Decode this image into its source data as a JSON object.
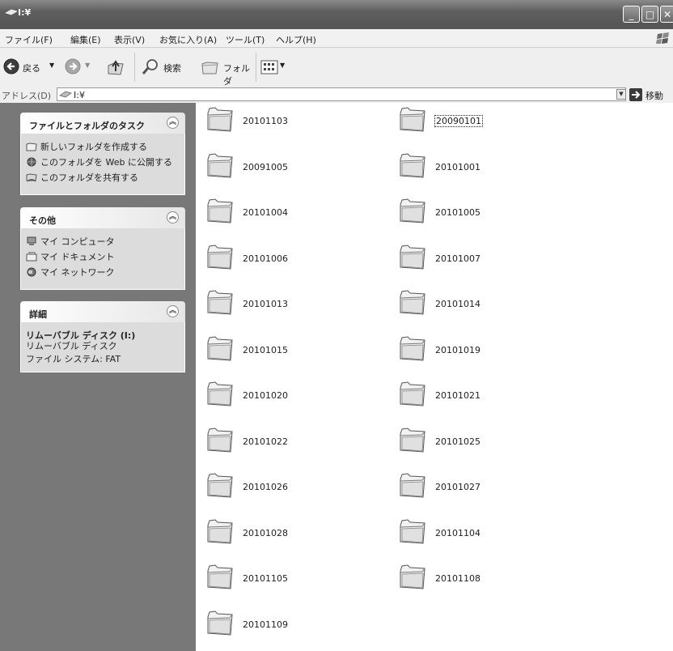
{
  "window": {
    "title": "I:¥"
  },
  "menubar": {
    "items": [
      "ファイル(F)",
      "編集(E)",
      "表示(V)",
      "お気に入り(A)",
      "ツール(T)",
      "ヘルプ(H)"
    ]
  },
  "toolbar": {
    "back_label": "戻る",
    "search_label": "検索",
    "folders_label": "フォルダ"
  },
  "addressbar": {
    "label": "アドレス(D)",
    "value": "I:¥",
    "go_label": "移動"
  },
  "leftpane": {
    "tasks_panel": {
      "title": "ファイルとフォルダのタスク",
      "items": [
        "新しいフォルダを作成する",
        "このフォルダを Web に公開する",
        "このフォルダを共有する"
      ]
    },
    "other_panel": {
      "title": "その他",
      "items": [
        "マイ コンピュータ",
        "マイ ドキュメント",
        "マイ ネットワーク"
      ]
    },
    "details_panel": {
      "title": "詳細",
      "drive_name": "リムーバブル ディスク (I:)",
      "drive_type": "リムーバブル ディスク",
      "filesystem": "ファイル システム: FAT"
    }
  },
  "folders": {
    "col1": [
      "20101103",
      "20091005",
      "20101004",
      "20101006",
      "20101013",
      "20101015",
      "20101020",
      "20101022",
      "20101026",
      "20101028",
      "20101105",
      "20101109"
    ],
    "col2": [
      "20090101",
      "20101001",
      "20101005",
      "20101007",
      "20101014",
      "20101019",
      "20101021",
      "20101025",
      "20101027",
      "20101104",
      "20101108"
    ],
    "selected": "20090101"
  }
}
